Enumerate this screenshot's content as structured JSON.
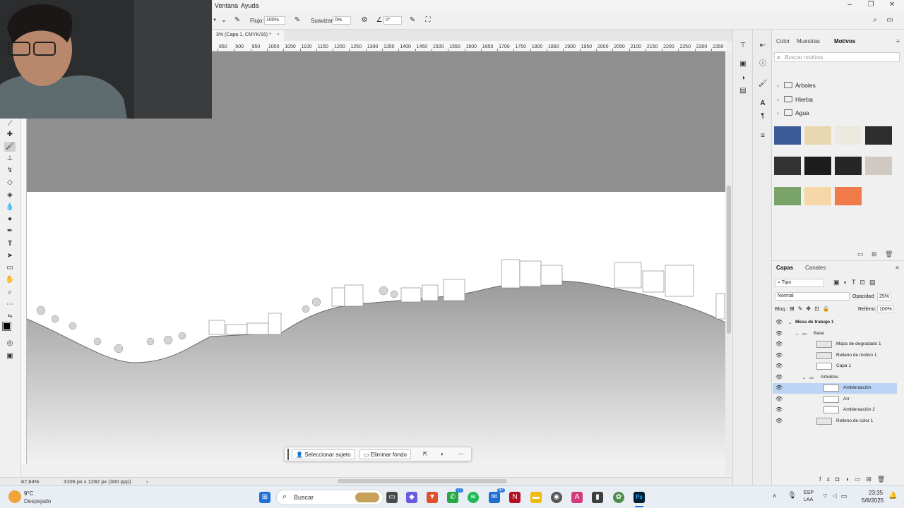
{
  "menubar": {
    "items": [
      "Ventana",
      "Ayuda"
    ]
  },
  "options_bar": {
    "flujo_label": "Flujo:",
    "flujo_value": "100%",
    "suavizar_label": "Suavizar:",
    "suavizar_value": "0%",
    "angle_value": "0°"
  },
  "document": {
    "tab_title": "3% (Capa 1, CMYK/16) *"
  },
  "ruler": {
    "ticks": [
      "850",
      "900",
      "950",
      "1000",
      "1050",
      "1100",
      "1150",
      "1200",
      "1250",
      "1300",
      "1350",
      "1400",
      "1450",
      "1500",
      "1550",
      "1600",
      "1650",
      "1700",
      "1750",
      "1800",
      "1850",
      "1900",
      "1950",
      "2000",
      "2050",
      "2100",
      "2150",
      "2200",
      "2250",
      "2300",
      "2350",
      "24"
    ]
  },
  "status": {
    "zoom": "67,64%",
    "doc_size": "3106 px x 1282 px (300 ppp)"
  },
  "context_bar": {
    "select_subject": "Seleccionar sujeto",
    "remove_bg": "Eliminar fondo"
  },
  "panel_top": {
    "tabs": [
      "Color",
      "Muestras",
      "Motivos"
    ],
    "active_tab": "Motivos",
    "search_placeholder": "Buscar motivos",
    "folders": [
      "Árboles",
      "Hierba",
      "Agua"
    ],
    "swatch_colors": [
      "#3b5a96",
      "#e9d7b0",
      "#eee9df",
      "#2d2d2d",
      "#333333",
      "#1c1c1c",
      "#262626",
      "#cfc9c2",
      "#7aa36a",
      "#f5d7a8",
      "#f07a4a"
    ]
  },
  "layers_panel": {
    "tabs": [
      "Capas",
      "Canales"
    ],
    "filter": "Tipo",
    "blend_mode": "Normal",
    "opacity_label": "Opacidad:",
    "opacity_value": "25%",
    "lock_label": "Bloq.:",
    "fill_label": "Relleno:",
    "fill_value": "100%",
    "layers": [
      {
        "name": "Mesa de trabajo 1",
        "indent": 0,
        "kind": "artboard"
      },
      {
        "name": "Base",
        "indent": 1,
        "kind": "group"
      },
      {
        "name": "Mapa de degradado 1",
        "indent": 2,
        "kind": "adjust"
      },
      {
        "name": "Relleno de motivo 1",
        "indent": 2,
        "kind": "adjust"
      },
      {
        "name": "Capa 1",
        "indent": 2,
        "kind": "pixel"
      },
      {
        "name": "Arbolitos",
        "indent": 2,
        "kind": "group"
      },
      {
        "name": "Ambientación",
        "indent": 3,
        "kind": "pixel",
        "selected": true
      },
      {
        "name": "Arr",
        "indent": 3,
        "kind": "pixel"
      },
      {
        "name": "Ambientación 2",
        "indent": 3,
        "kind": "pixel"
      },
      {
        "name": "Relleno de color 1",
        "indent": 2,
        "kind": "adjust"
      }
    ]
  },
  "taskbar": {
    "weather_temp": "9°C",
    "weather_desc": "Despejado",
    "search_label": "Buscar",
    "lang_top": "ESP",
    "lang_bottom": "LAA",
    "time": "23:35",
    "date": "5/8/2025",
    "notif_badge_1": "77",
    "notif_badge_2": "47"
  }
}
